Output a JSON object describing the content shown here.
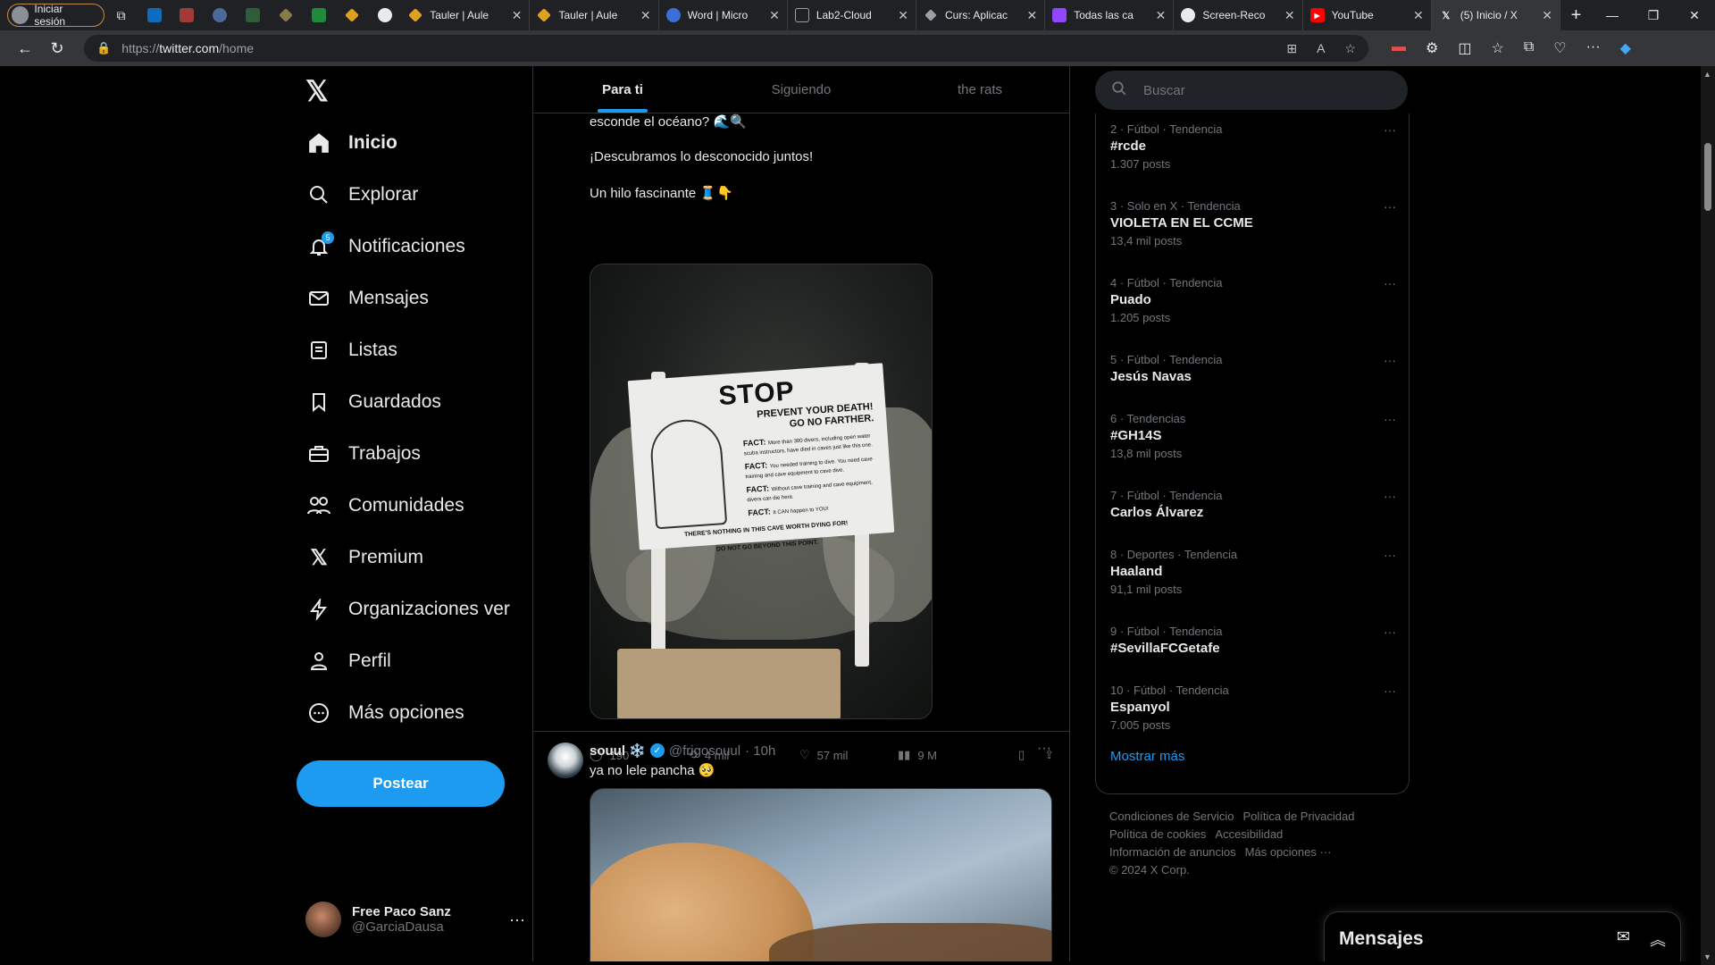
{
  "browser": {
    "profile_label": "Iniciar sesión",
    "tabs": [
      {
        "title": "Tauler | Aule",
        "color": "#e0a020"
      },
      {
        "title": "Tauler | Aule",
        "color": "#e0a020"
      },
      {
        "title": "Word | Micro",
        "color": "#3b6fd8"
      },
      {
        "title": "Lab2-Cloud",
        "color": "#9aa0a6"
      },
      {
        "title": "Curs: Aplicac",
        "color": "#9aa0a6"
      },
      {
        "title": "Todas las ca",
        "color": "#9146ff"
      },
      {
        "title": "Screen-Reco",
        "color": "#e8eaed"
      },
      {
        "title": "YouTube",
        "color": "#ff0000"
      },
      {
        "title": "(5) Inicio / X",
        "color": "#e8eaed"
      }
    ],
    "url_scheme": "https://",
    "url_host": "twitter.com",
    "url_path": "/home"
  },
  "nav": {
    "items": [
      {
        "label": "Inicio",
        "icon": "home-icon"
      },
      {
        "label": "Explorar",
        "icon": "search-icon"
      },
      {
        "label": "Notificaciones",
        "icon": "bell-icon"
      },
      {
        "label": "Mensajes",
        "icon": "mail-icon"
      },
      {
        "label": "Listas",
        "icon": "list-icon"
      },
      {
        "label": "Guardados",
        "icon": "bookmark-icon"
      },
      {
        "label": "Trabajos",
        "icon": "briefcase-icon"
      },
      {
        "label": "Comunidades",
        "icon": "people-icon"
      },
      {
        "label": "Premium",
        "icon": "x-logo-icon"
      },
      {
        "label": "Organizaciones ver",
        "icon": "lightning-icon"
      },
      {
        "label": "Perfil",
        "icon": "person-icon"
      },
      {
        "label": "Más opciones",
        "icon": "more-circle-icon"
      }
    ],
    "notif_badge": "5",
    "post_label": "Postear",
    "account": {
      "name": "Free Paco Sanz",
      "handle": "@GarciaDausa"
    }
  },
  "feed": {
    "tabs": [
      "Para ti",
      "Siguiendo",
      "the rats"
    ],
    "tweet1": {
      "lines": [
        "esconde el océano? 🌊🔍",
        "¡Descubramos lo desconocido juntos!",
        "Un hilo fascinante 🧵👇"
      ],
      "sign": {
        "title": "STOP",
        "subtitle1": "PREVENT YOUR DEATH!",
        "subtitle2": "GO NO FARTHER.",
        "fact_label": "FACT:",
        "facts": [
          "More than 300 divers, including open water scuba instructors, have died in caves just like this one.",
          "You needed training to dive. You need cave training and cave equipment to cave dive.",
          "Without cave training and cave equipment, divers can die here.",
          "It CAN happen to YOU!"
        ],
        "footer1": "THERE'S NOTHING IN THIS CAVE WORTH DYING FOR!",
        "footer2": "DO NOT GO BEYOND THIS POINT."
      },
      "replies": "190",
      "reposts": "4 mil",
      "likes": "57 mil",
      "views": "9 M"
    },
    "tweet2": {
      "name": "souul ❄️",
      "handle": "@frigosouul",
      "time": "· 10h",
      "text": "ya no lele pancha 🥺"
    }
  },
  "right": {
    "search_placeholder": "Buscar",
    "trends": [
      {
        "meta": "2 · Fútbol · Tendencia",
        "title": "#rcde",
        "posts": "1.307 posts"
      },
      {
        "meta": "3 · Solo en X · Tendencia",
        "title": "VIOLETA EN EL CCME",
        "posts": "13,4 mil posts"
      },
      {
        "meta": "4 · Fútbol · Tendencia",
        "title": "Puado",
        "posts": "1.205 posts"
      },
      {
        "meta": "5 · Fútbol · Tendencia",
        "title": "Jesús Navas",
        "posts": ""
      },
      {
        "meta": "6 · Tendencias",
        "title": "#GH14S",
        "posts": "13,8 mil posts"
      },
      {
        "meta": "7 · Fútbol · Tendencia",
        "title": "Carlos Álvarez",
        "posts": ""
      },
      {
        "meta": "8 · Deportes · Tendencia",
        "title": "Haaland",
        "posts": "91,1 mil posts"
      },
      {
        "meta": "9 · Fútbol · Tendencia",
        "title": "#SevillaFCGetafe",
        "posts": ""
      },
      {
        "meta": "10 · Fútbol · Tendencia",
        "title": "Espanyol",
        "posts": "7.005 posts"
      }
    ],
    "show_more": "Mostrar más",
    "footer_links": [
      "Condiciones de Servicio",
      "Política de Privacidad",
      "Política de cookies",
      "Accesibilidad",
      "Información de anuncios",
      "Más opciones ···"
    ],
    "copyright": "© 2024 X Corp."
  },
  "messages_drawer": {
    "title": "Mensajes"
  }
}
